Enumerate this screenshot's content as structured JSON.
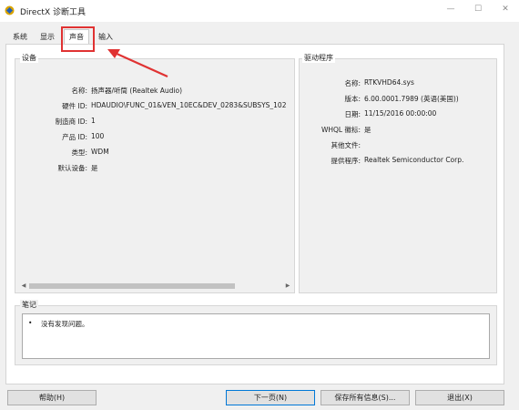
{
  "window": {
    "title": "DirectX 诊断工具",
    "minimize_glyph": "—",
    "maximize_glyph": "☐",
    "close_glyph": "✕"
  },
  "tabs": [
    {
      "label": "系统",
      "active": false
    },
    {
      "label": "显示",
      "active": false
    },
    {
      "label": "声音",
      "active": true
    },
    {
      "label": "输入",
      "active": false
    }
  ],
  "device": {
    "section_title": "设备",
    "fields": [
      {
        "label": "名称:",
        "value": "扬声器/听筒 (Realtek Audio)"
      },
      {
        "label": "硬件 ID:",
        "value": "HDAUDIO\\FUNC_01&VEN_10EC&DEV_0283&SUBSYS_102"
      },
      {
        "label": "制造商 ID:",
        "value": "1"
      },
      {
        "label": "产品 ID:",
        "value": "100"
      },
      {
        "label": "类型:",
        "value": "WDM"
      },
      {
        "label": "默认设备:",
        "value": "是"
      }
    ]
  },
  "driver": {
    "section_title": "驱动程序",
    "fields": [
      {
        "label": "名称:",
        "value": "RTKVHD64.sys"
      },
      {
        "label": "版本:",
        "value": "6.00.0001.7989 (英语(美国))"
      },
      {
        "label": "日期:",
        "value": "11/15/2016 00:00:00"
      },
      {
        "label": "WHQL 徽标:",
        "value": "是"
      },
      {
        "label": "其他文件:",
        "value": ""
      },
      {
        "label": "提供程序:",
        "value": "Realtek Semiconductor Corp."
      }
    ]
  },
  "notes": {
    "section_title": "笔记",
    "items": [
      "没有发现问题。"
    ]
  },
  "buttons": {
    "help": "帮助(H)",
    "next": "下一页(N)",
    "save_all": "保存所有信息(S)...",
    "exit": "退出(X)"
  },
  "colors": {
    "annotation_red": "#e03232",
    "accent_blue": "#0078d7"
  },
  "icons": {
    "app": "directx-icon",
    "scroll_left": "arrow-left-icon",
    "scroll_right": "arrow-right-icon",
    "annotation": "red-arrow-annotation"
  }
}
